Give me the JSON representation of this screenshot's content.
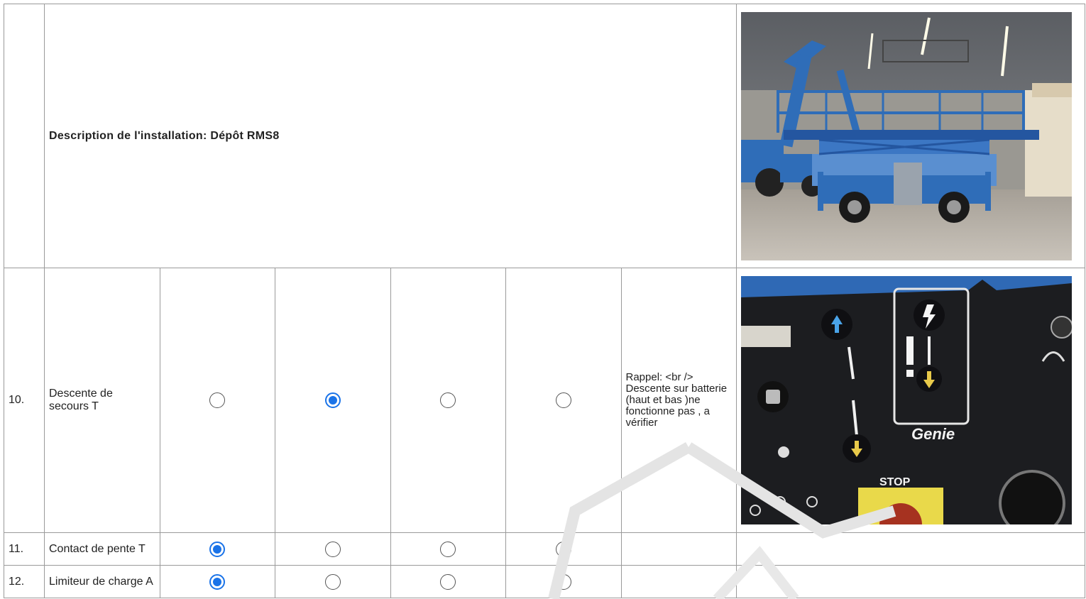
{
  "installation": {
    "description_label": "Description de l'installation: Dépôt RMS8"
  },
  "photos": {
    "top": "scissor-lift-photo",
    "control_panel": "control-panel-photo",
    "panel_brand": "Genie",
    "panel_stop": "STOP"
  },
  "rows": [
    {
      "number": "10.",
      "label": "Descente de secours T",
      "selected_option": 2,
      "remark": "Rappel: <br /> Descente sur batterie (haut et bas )ne fonctionne pas , a vérifier"
    },
    {
      "number": "11.",
      "label": "Contact de pente T",
      "selected_option": 1,
      "remark": ""
    },
    {
      "number": "12.",
      "label": "Limiteur de charge A",
      "selected_option": 1,
      "remark": ""
    }
  ],
  "colors": {
    "radio_checked": "#1a73e8",
    "border": "#9a9a9a",
    "lift_blue": "#2f6db8"
  }
}
